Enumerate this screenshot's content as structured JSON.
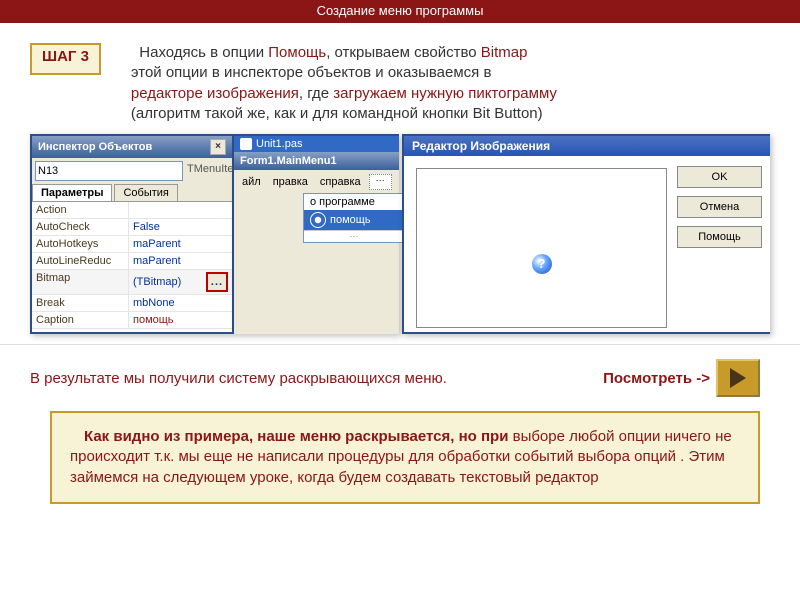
{
  "title": "Создание меню программы",
  "step": {
    "label": "ШАГ 3"
  },
  "instruction": {
    "p1a": "Находясь в опции ",
    "p1b": "Помощь",
    "p1c": ", открываем свойство ",
    "p1d": "Bitmap",
    "p2a": "этой опции в инспекторе объектов и оказываемся в ",
    "p3a": "редакторе изображения",
    "p3b": ", где ",
    "p3c": "загружаем нужную пиктограмму",
    "p4": " (алгоритм такой же, как и для командной кнопки Bit Button)"
  },
  "inspector": {
    "title": "Инспектор Объектов",
    "close": "×",
    "selectedName": "N13",
    "selectedClass": "TMenuItem",
    "tabs": {
      "params": "Параметры",
      "events": "События"
    },
    "rows": [
      {
        "n": "Action",
        "v": ""
      },
      {
        "n": "AutoCheck",
        "v": "False"
      },
      {
        "n": "AutoHotkeys",
        "v": "maParent"
      },
      {
        "n": "AutoLineReduc",
        "v": "maParent"
      },
      {
        "n": "Bitmap",
        "v": "(TBitmap)",
        "ellipsis": true,
        "sel": true
      },
      {
        "n": "Break",
        "v": "mbNone"
      },
      {
        "n": "Caption",
        "v": "помощь"
      }
    ],
    "ellipsisLabel": "..."
  },
  "menuEditor": {
    "tab": "Unit1.pas",
    "caption": "Form1.MainMenu1",
    "menubar": {
      "file": "айл",
      "edit": "правка",
      "help": "справка"
    },
    "items": {
      "about": "о программе",
      "help": "помощь"
    }
  },
  "imageEditor": {
    "title": "Редактор Изображения",
    "q": "?",
    "buttons": {
      "ok": "OK",
      "cancel": "Отмена",
      "help": "Помощь"
    }
  },
  "result": {
    "text": "В результате мы получили систему раскрывающихся меню.",
    "link": "Посмотреть ->"
  },
  "note": {
    "lead": "Как видно из примера, наше меню раскрывается, но при ",
    "body": "выборе любой опции ничего не происходит  т.к.  мы еще не написали процедуры для обработки событий выбора опций . Этим займемся на следующем уроке, когда будем создавать текстовый редактор"
  }
}
